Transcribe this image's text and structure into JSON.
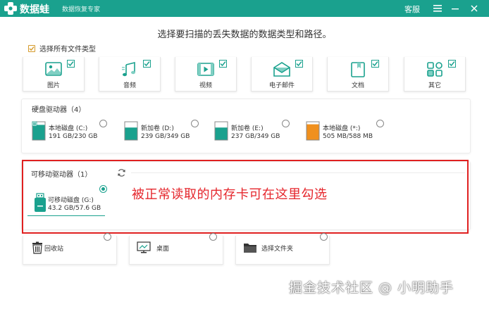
{
  "app": {
    "name": "数据蛙",
    "subtitle": "数据恢复专家",
    "service": "客服"
  },
  "headline": "选择要扫描的丢失数据的数据类型和路径。",
  "select_all": {
    "label": "选择所有文件类型",
    "checked": true
  },
  "file_types": [
    {
      "label": "图片",
      "icon": "image-icon",
      "checked": true
    },
    {
      "label": "音频",
      "icon": "music-icon",
      "checked": true
    },
    {
      "label": "视频",
      "icon": "video-icon",
      "checked": true
    },
    {
      "label": "电子邮件",
      "icon": "email-icon",
      "checked": true
    },
    {
      "label": "文档",
      "icon": "document-icon",
      "checked": true
    },
    {
      "label": "其它",
      "icon": "other-icon",
      "checked": true
    }
  ],
  "hard_drives": {
    "title": "硬盘驱动器（4）",
    "items": [
      {
        "name": "本地磁盘 (C:)",
        "size": "191 GB/230 GB",
        "color": "#1aa18e",
        "used_fraction": 0.83,
        "has_windows_logo": true
      },
      {
        "name": "新加卷 (D:)",
        "size": "239 GB/349 GB",
        "color": "#1aa18e",
        "used_fraction": 0.68
      },
      {
        "name": "新加卷 (E:)",
        "size": "237 GB/349 GB",
        "color": "#1aa18e",
        "used_fraction": 0.68
      },
      {
        "name": "本地磁盘 (*:)",
        "size": "505 MB/588 MB",
        "color": "#f0901e",
        "used_fraction": 0.86
      }
    ]
  },
  "removable": {
    "title": "可移动驱动器（1）",
    "items": [
      {
        "name": "可移动磁盘 (G:)",
        "size": "43.2 GB/57.6 GB",
        "selected": true
      }
    ]
  },
  "annotation": "被正常读取的内存卡可在这里勾选",
  "locations": [
    {
      "label": "回收站",
      "icon": "recycle-bin-icon"
    },
    {
      "label": "桌面",
      "icon": "desktop-icon"
    },
    {
      "label": "选择文件夹",
      "icon": "folder-icon"
    }
  ],
  "watermark": "掘金技术社区 @ 小明助手",
  "colors": {
    "accent": "#1aa18e",
    "annotation": "#e5262c",
    "checkbox": "#d59a2a",
    "drive_orange": "#f0901e"
  }
}
